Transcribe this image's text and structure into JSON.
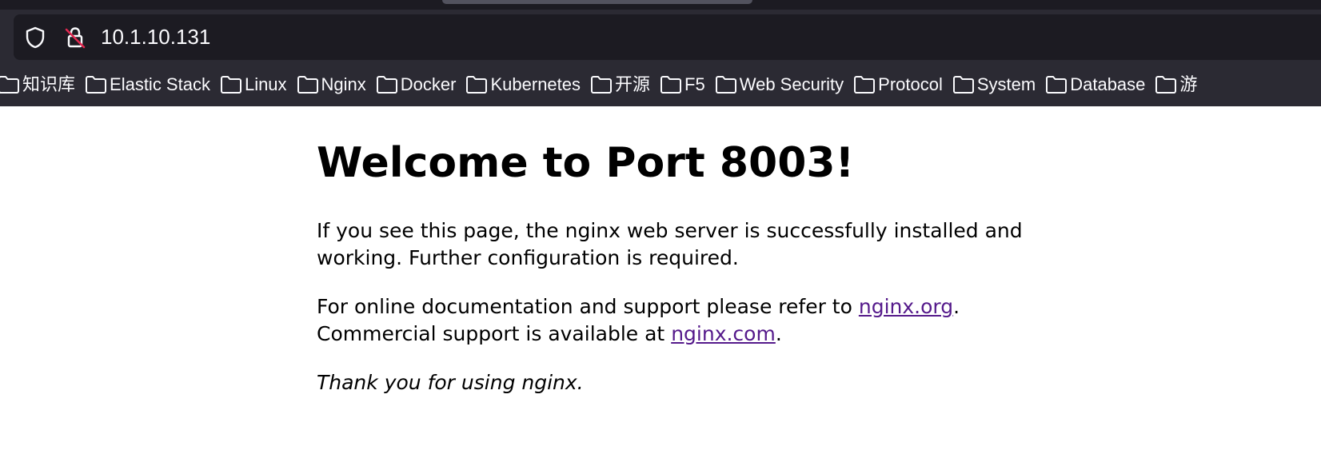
{
  "browser": {
    "address": "10.1.10.131",
    "bookmarks": [
      {
        "label": "知识库"
      },
      {
        "label": "Elastic Stack"
      },
      {
        "label": "Linux"
      },
      {
        "label": "Nginx"
      },
      {
        "label": "Docker"
      },
      {
        "label": "Kubernetes"
      },
      {
        "label": "开源"
      },
      {
        "label": "F5"
      },
      {
        "label": "Web Security"
      },
      {
        "label": "Protocol"
      },
      {
        "label": "System"
      },
      {
        "label": "Database"
      },
      {
        "label": "游"
      }
    ],
    "icons": {
      "shield": "shield-icon",
      "lock": "insecure-lock-icon",
      "folder": "folder-icon"
    },
    "colors": {
      "chrome": "#2b2a33",
      "urlbar": "#1c1b22",
      "insecure": "#e22850",
      "link": "#551a8b"
    }
  },
  "page": {
    "heading": "Welcome to Port 8003!",
    "para1": "If you see this page, the nginx web server is successfully installed and working. Further configuration is required.",
    "para2_prefix": "For online documentation and support please refer to ",
    "link_org": "nginx.org",
    "para2_mid": ".",
    "para2_line2": "Commercial support is available at ",
    "link_com": "nginx.com",
    "para2_end": ".",
    "thanks": "Thank you for using nginx."
  }
}
